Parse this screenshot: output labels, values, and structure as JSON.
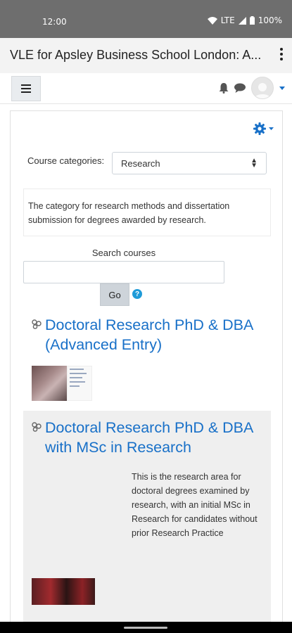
{
  "status": {
    "time": "12:00",
    "network": "LTE",
    "battery": "100%"
  },
  "app": {
    "title": "VLE for Apsley Business School London: A..."
  },
  "categories": {
    "label": "Course categories:",
    "selected": "Research"
  },
  "category_description": "The category for research methods and dissertation submission for degrees awarded by research.",
  "search": {
    "label": "Search courses",
    "value": "",
    "go_label": "Go",
    "help": "?"
  },
  "courses": [
    {
      "title": "Doctoral Research PhD & DBA (Advanced Entry)",
      "summary": ""
    },
    {
      "title": "Doctoral Research PhD & DBA with MSc in Research",
      "summary": "This is the research area for doctoral degrees examined by research, with an initial MSc in Research for candidates without prior Research Practice"
    }
  ],
  "colors": {
    "link": "#1870c8",
    "help": "#1f9bd8",
    "statusbar": "#6e6e6e"
  }
}
